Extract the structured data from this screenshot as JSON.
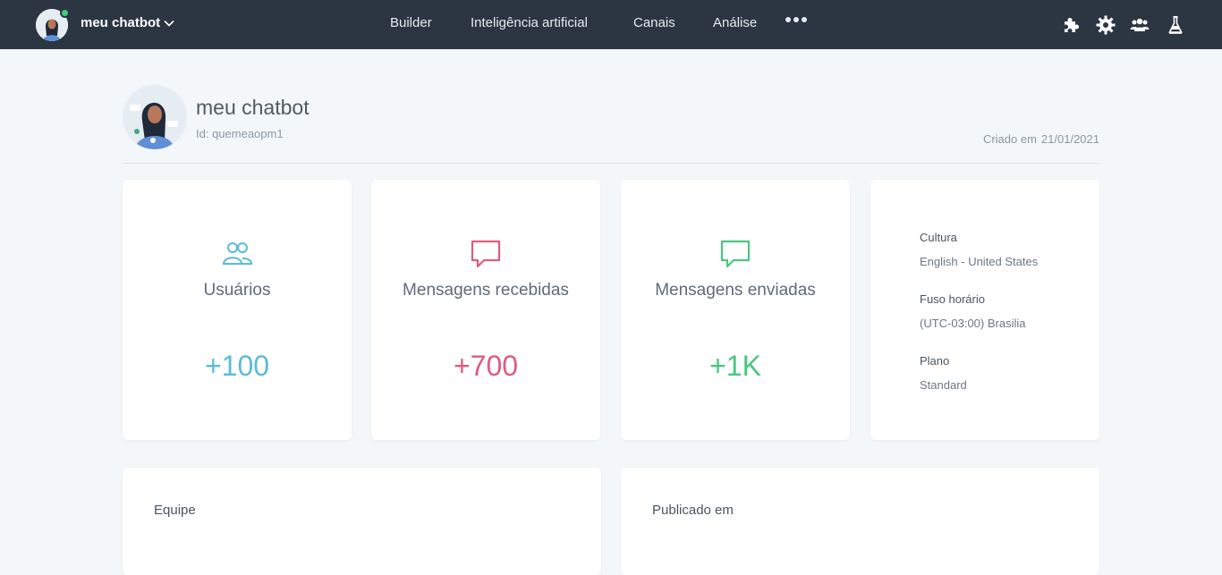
{
  "header": {
    "bot_name": "meu chatbot",
    "nav": [
      "Builder",
      "Inteligência artificial",
      "Canais",
      "Análise"
    ],
    "tool_icons": [
      "puzzle-icon",
      "gear-icon",
      "team-icon",
      "flask-icon"
    ]
  },
  "bot": {
    "name": "meu chatbot",
    "id_text": "Id: quemeaopm1",
    "created_label": "Criado em",
    "created_date": "21/01/2021"
  },
  "stats": [
    {
      "label": "Usuários",
      "value": "+100",
      "icon": "users-icon",
      "color": "#5bbcd6"
    },
    {
      "label": "Mensagens recebidas",
      "value": "+700",
      "icon": "chat-bubble-icon",
      "color": "#e05a7f"
    },
    {
      "label": "Mensagens enviadas",
      "value": "+1K",
      "icon": "chat-bubble-icon",
      "color": "#49c77f"
    }
  ],
  "info": {
    "culture_label": "Cultura",
    "culture_value": "English - United States",
    "timezone_label": "Fuso horário",
    "timezone_value": "(UTC-03:00) Brasilia",
    "plan_label": "Plano",
    "plan_value": "Standard"
  },
  "sections": {
    "team_title": "Equipe",
    "published_title": "Publicado em"
  }
}
